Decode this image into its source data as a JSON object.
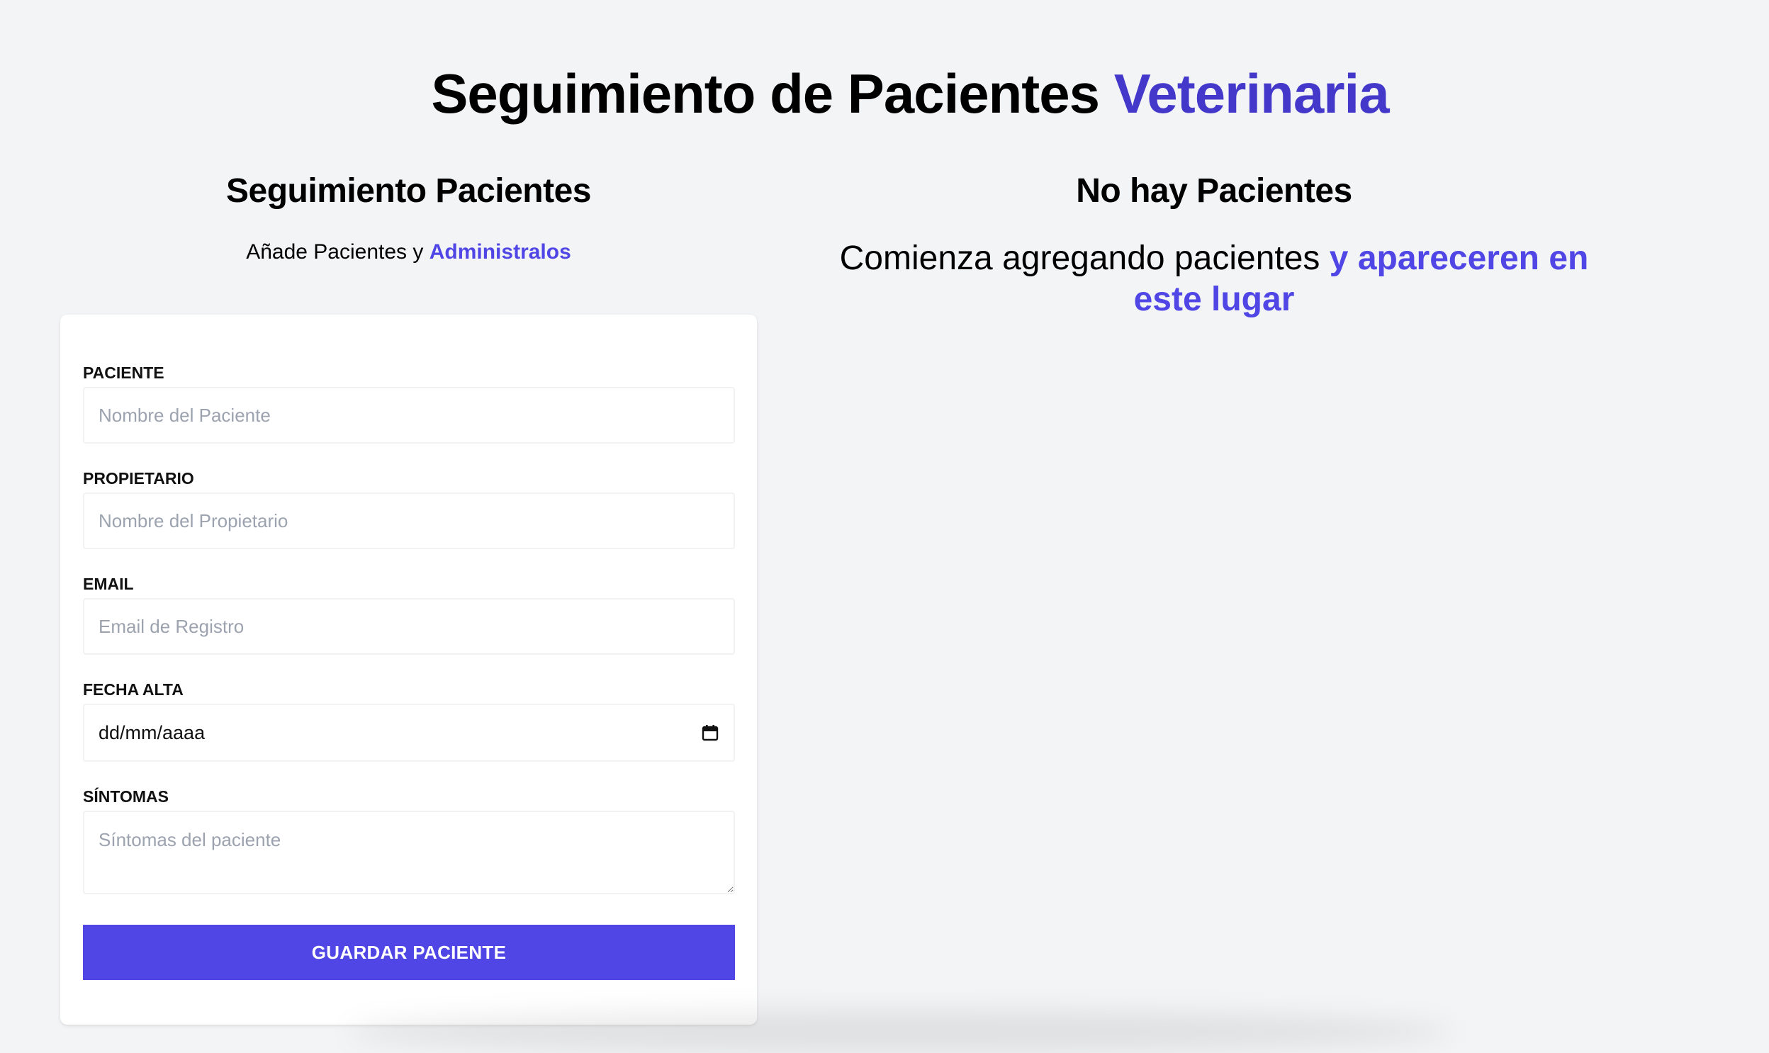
{
  "header": {
    "title_main": "Seguimiento de Pacientes",
    "title_accent": "Veterinaria"
  },
  "form_section": {
    "title": "Seguimiento Pacientes",
    "subtitle_plain": "Añade Pacientes y",
    "subtitle_accent": "Administralos"
  },
  "form": {
    "fields": [
      {
        "label": "PACIENTE",
        "placeholder": "Nombre del Paciente",
        "value": ""
      },
      {
        "label": "PROPIETARIO",
        "placeholder": "Nombre del Propietario",
        "value": ""
      },
      {
        "label": "EMAIL",
        "placeholder": "Email de Registro",
        "value": ""
      },
      {
        "label": "FECHA ALTA",
        "placeholder": "dd/mm/aaaa",
        "value": ""
      },
      {
        "label": "SÍNTOMAS",
        "placeholder": "Síntomas del paciente",
        "value": ""
      }
    ],
    "submit_label": "GUARDAR PACIENTE",
    "date_icon": "calendar-icon"
  },
  "list_section": {
    "title": "No hay Pacientes",
    "message_plain": "Comienza agregando pacientes",
    "message_accent": "y apareceren en este lugar"
  },
  "colors": {
    "background": "#f3f4f6",
    "accent": "#4338ca",
    "button": "#4f46e5",
    "card": "#ffffff"
  }
}
